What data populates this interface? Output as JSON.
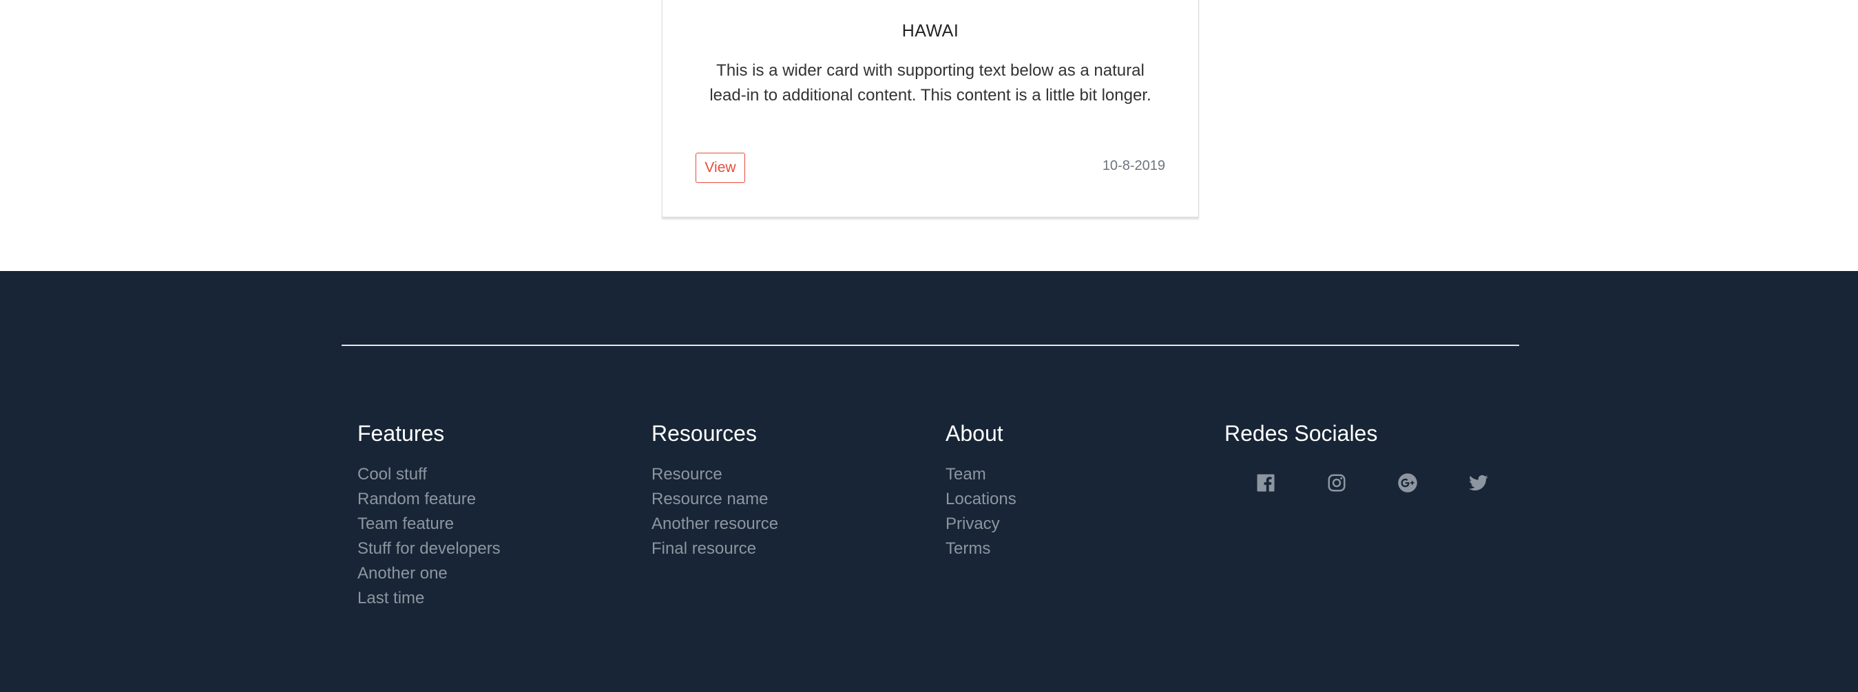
{
  "card": {
    "title": "HAWAI",
    "text": "This is a wider card with supporting text below as a natural lead-in to additional content. This content is a little bit longer.",
    "button_label": "View",
    "date": "10-8-2019"
  },
  "footer": {
    "columns": [
      {
        "title": "Features",
        "links": [
          "Cool stuff",
          "Random feature",
          "Team feature",
          "Stuff for developers",
          "Another one",
          "Last time"
        ]
      },
      {
        "title": "Resources",
        "links": [
          "Resource",
          "Resource name",
          "Another resource",
          "Final resource"
        ]
      },
      {
        "title": "About",
        "links": [
          "Team",
          "Locations",
          "Privacy",
          "Terms"
        ]
      }
    ],
    "social": {
      "title": "Redes Sociales",
      "icons": [
        "facebook-icon",
        "instagram-icon",
        "google-plus-icon",
        "twitter-icon"
      ]
    }
  },
  "colors": {
    "footer_bg": "#172536",
    "accent_red": "#e74c3c",
    "muted_link": "#8d96a0"
  }
}
